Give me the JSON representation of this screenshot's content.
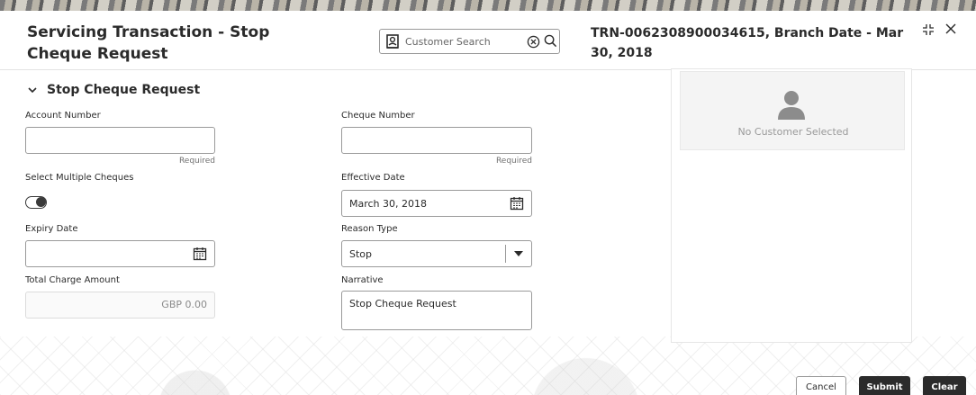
{
  "header": {
    "title": "Servicing Transaction - Stop Cheque Request",
    "search": {
      "placeholder": "Customer Search"
    },
    "transaction_info": "TRN-0062308900034615, Branch Date - Mar 30, 2018"
  },
  "section": {
    "title": "Stop Cheque Request"
  },
  "form": {
    "account_number": {
      "label": "Account Number",
      "value": "",
      "hint": "Required"
    },
    "cheque_number": {
      "label": "Cheque Number",
      "value": "",
      "hint": "Required"
    },
    "select_multiple": {
      "label": "Select Multiple Cheques",
      "state": "off"
    },
    "effective_date": {
      "label": "Effective Date",
      "value": "March 30, 2018"
    },
    "expiry_date": {
      "label": "Expiry Date",
      "value": ""
    },
    "reason_type": {
      "label": "Reason Type",
      "value": "Stop"
    },
    "total_charge": {
      "label": "Total Charge Amount",
      "value": "GBP 0.00"
    },
    "narrative": {
      "label": "Narrative",
      "value": "Stop Cheque Request"
    }
  },
  "customer_panel": {
    "empty_text": "No Customer Selected"
  },
  "actions": {
    "cancel": "Cancel",
    "submit": "Submit",
    "clear": "Clear"
  },
  "icons": [
    "person-search-icon",
    "clear-circle-icon",
    "search-icon",
    "collapse-icon",
    "close-icon",
    "chevron-down-icon",
    "calendar-icon",
    "caret-down-icon",
    "avatar-icon"
  ]
}
